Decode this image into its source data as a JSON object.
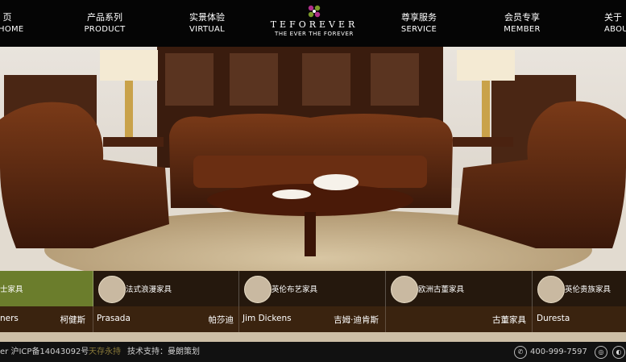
{
  "nav": {
    "items": [
      {
        "cn": "页",
        "en": "HOME"
      },
      {
        "cn": "产品系列",
        "en": "PRODUCT"
      },
      {
        "cn": "实景体验",
        "en": "VIRTUAL"
      },
      {
        "cn": "尊享服务",
        "en": "SERVICE"
      },
      {
        "cn": "会员专享",
        "en": "MEMBER"
      },
      {
        "cn": "关于",
        "en": "ABOU"
      }
    ]
  },
  "logo": {
    "brand": "TEFOREVER",
    "tagline": "THE EVER THE FOREVER"
  },
  "categories": [
    {
      "label": "士家具"
    },
    {
      "label": "法式浪漫家具"
    },
    {
      "label": "英伦布艺家具"
    },
    {
      "label": "欧洲古董家具"
    },
    {
      "label": "英伦贵族家具"
    }
  ],
  "brands": [
    {
      "left": "ners",
      "right": "柯健斯"
    },
    {
      "left": "Prasada",
      "right": "帕莎迪"
    },
    {
      "left": "Jim Dickens",
      "right": "吉姆·迪肯斯"
    },
    {
      "left": "",
      "right": "古董家具"
    },
    {
      "left": "Duresta",
      "right": ""
    }
  ],
  "footer": {
    "icp": "er 沪ICP备14043092号",
    "highlight": "天存永持",
    "support": "技术支持：曼朗策划",
    "phone": "400-999-7597"
  },
  "colors": {
    "active_category": "#6b7d2c",
    "leather": "#5a2a12",
    "footer_bg": "#111111"
  }
}
